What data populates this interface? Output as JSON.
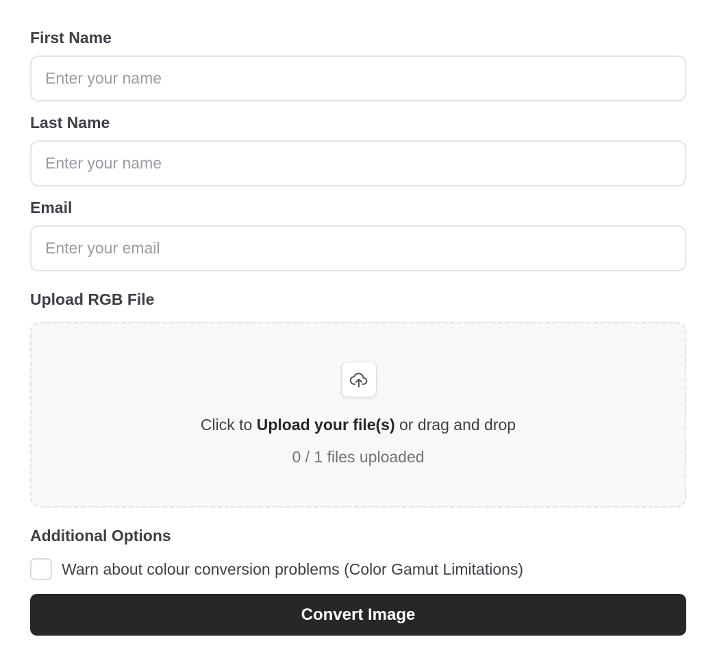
{
  "form": {
    "first_name": {
      "label": "First Name",
      "value": "",
      "placeholder": "Enter your name"
    },
    "last_name": {
      "label": "Last Name",
      "value": "",
      "placeholder": "Enter your name"
    },
    "email": {
      "label": "Email",
      "value": "",
      "placeholder": "Enter your email"
    },
    "upload": {
      "label": "Upload RGB File",
      "icon": "cloud-upload-icon",
      "prompt_prefix": "Click to ",
      "prompt_emphasis": "Upload your file(s)",
      "prompt_suffix": " or drag and drop",
      "status": "0 / 1 files uploaded"
    },
    "options": {
      "heading": "Additional Options",
      "warn_gamut": {
        "label": "Warn about colour conversion problems (Color Gamut Limitations)",
        "checked": false
      }
    },
    "submit_label": "Convert Image"
  },
  "colors": {
    "button_background": "#27272a",
    "button_text": "#ffffff",
    "dropzone_background": "#f8f8f8",
    "border": "#e4e4e7"
  }
}
